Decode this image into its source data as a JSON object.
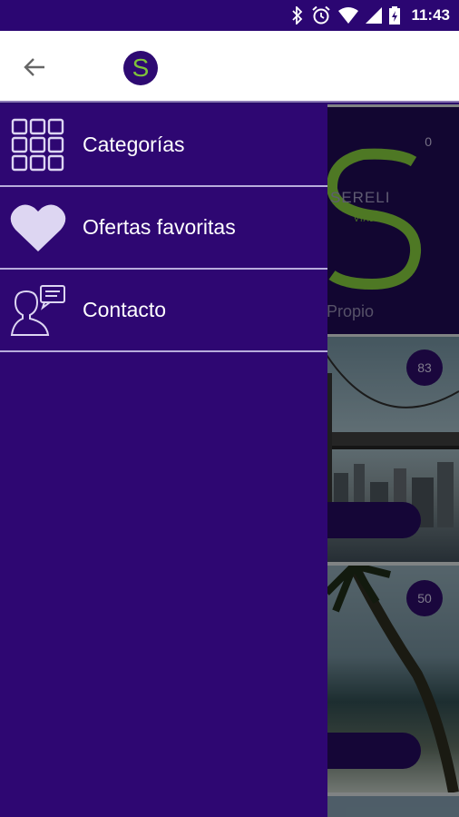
{
  "status_bar": {
    "time": "11:43",
    "icons": [
      "bluetooth-icon",
      "alarm-icon",
      "wifi-icon",
      "cell-signal-icon",
      "battery-charging-icon"
    ]
  },
  "app_bar": {
    "back_icon": "arrow-back-icon",
    "logo_letter": "S"
  },
  "drawer": {
    "items": [
      {
        "label": "Categorías",
        "icon": "grid-icon"
      },
      {
        "label": "Ofertas favoritas",
        "icon": "heart-icon"
      },
      {
        "label": "Contacto",
        "icon": "contact-person-icon"
      }
    ]
  },
  "background": {
    "cards": [
      {
        "count": "0",
        "brand": "SERELI",
        "brand_sub": "VIAJES",
        "label": "Propio"
      },
      {
        "count": "83"
      },
      {
        "count": "50"
      }
    ]
  },
  "colors": {
    "primary": "#2e0772",
    "accent_green": "#7ec23a",
    "divider": "#b8acdc"
  }
}
